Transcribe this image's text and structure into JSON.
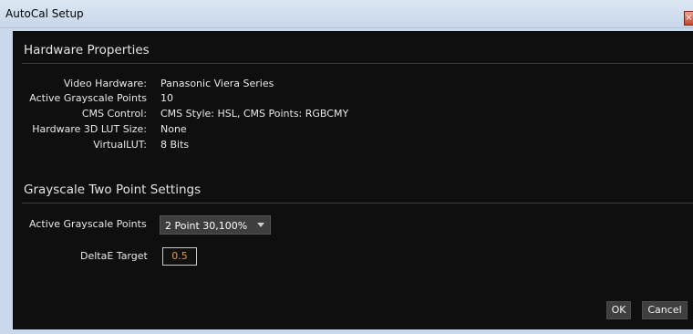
{
  "window": {
    "title": "AutoCal Setup",
    "close_label": "×"
  },
  "hardware": {
    "heading": "Hardware Properties",
    "properties": [
      {
        "label": "Video Hardware:",
        "value": "Panasonic Viera Series"
      },
      {
        "label": "Active Grayscale Points",
        "value": "10"
      },
      {
        "label": "CMS Control:",
        "value": "CMS Style: HSL, CMS Points: RGBCMY"
      },
      {
        "label": "Hardware 3D LUT Size:",
        "value": "None"
      },
      {
        "label": "VirtualLUT:",
        "value": "8 Bits"
      }
    ]
  },
  "grayscale": {
    "heading": "Grayscale Two Point Settings",
    "points_label": "Active Grayscale Points",
    "points_selected": "2 Point 30,100%",
    "deltae_label": "DeltaE Target",
    "deltae_value": "0.5"
  },
  "buttons": {
    "ok": "OK",
    "cancel": "Cancel"
  },
  "colors": {
    "panel_bg": "#0f0f0f",
    "titlebar_bg": "#c9d8ea",
    "accent_value": "#e29b2a"
  }
}
